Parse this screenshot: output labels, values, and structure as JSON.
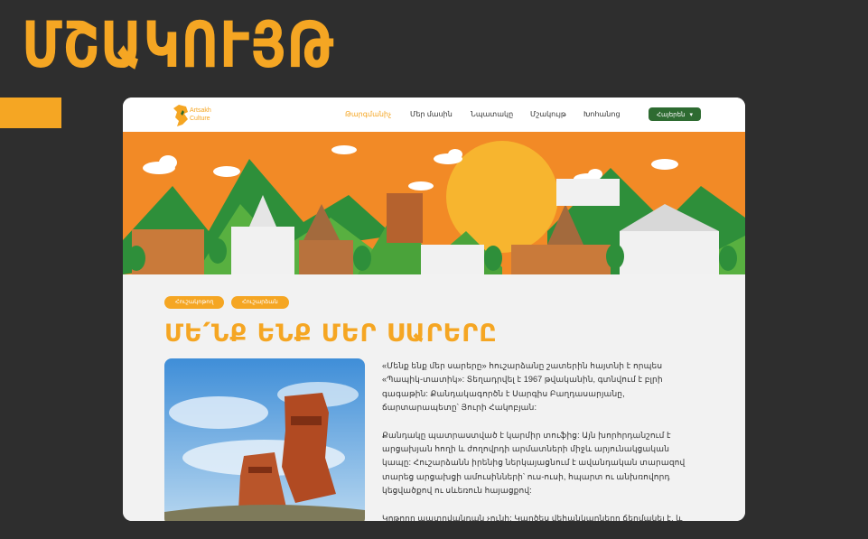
{
  "heading": "ՄՇԱԿՈՒՅԹ",
  "colors": {
    "accent": "#f5a623",
    "background": "#2e2e2e",
    "lang_button": "#2e6b31"
  },
  "nav": {
    "logo_text_line1": "Artsakh",
    "logo_text_line2": "Culture",
    "items": [
      {
        "label": "Թարգմանիչ",
        "active": true
      },
      {
        "label": "Մեր մասին",
        "active": false
      },
      {
        "label": "Նպատակը",
        "active": false
      },
      {
        "label": "Մշակույթ",
        "active": false
      },
      {
        "label": "Խոհանոց",
        "active": false
      }
    ],
    "language": "Հայերեն",
    "language_icon": "chevron-down-icon"
  },
  "tags": [
    "Հուշակոթող",
    "Հուշարձան"
  ],
  "article": {
    "title": "ՄԵ՛ՆՔ ԵՆՔ ՄԵՐ ՍԱՐԵՐԸ",
    "paragraphs": [
      "«Մենք ենք մեր սարերը» հուշարձանը շատերին հայտնի է որպես «Պապիկ-տատիկ»: Տեղադրվել է 1967 թվականին, գտնվում է բլրի գագաթին: Քանդակագործն է Սարգիս Բաղդասարյանը, ճարտարապետը՝ Յուրի Հակոբյան:",
      "Քանդակը պատրաստված է կարմիր տուֆից: Այն խորհրդանշում է արցախյան հողի և ժողովրդի արմատների միջև արյունակցական կապը: Հուշարձանն իրենից ներկայացնում է ավանդական տարազով տարեց արցախցի ամուսինների՝ ուս-ուսի, հպարտ ու անխռովորդ կեցվածքով ու սևեռուն հայացքով:",
      "Կոթողը պատրվանդան չունի: Կարծես վեհանկարները ճերմակել է, և"
    ]
  }
}
